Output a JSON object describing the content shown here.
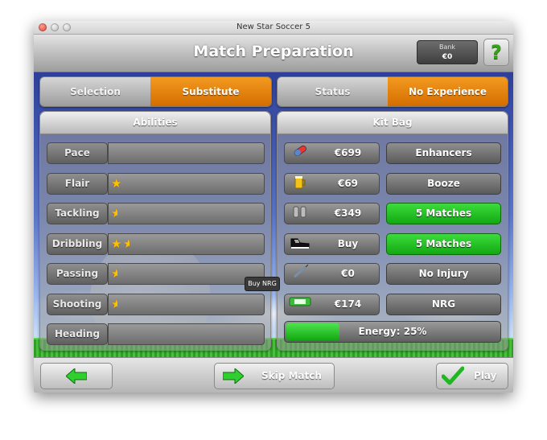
{
  "window": {
    "title": "New Star Soccer 5"
  },
  "header": {
    "title": "Match Preparation",
    "bank_label": "Bank",
    "bank_value": "€0",
    "help_label": "?"
  },
  "left_tabs": [
    {
      "label": "Selection",
      "active": false
    },
    {
      "label": "Substitute",
      "active": true
    }
  ],
  "right_tabs": [
    {
      "label": "Status",
      "active": false
    },
    {
      "label": "No Experience",
      "active": true
    }
  ],
  "abilities": {
    "title": "Abilities",
    "items": [
      {
        "label": "Pace",
        "stars": 0
      },
      {
        "label": "Flair",
        "stars": 1
      },
      {
        "label": "Tackling",
        "stars": 0.5
      },
      {
        "label": "Dribbling",
        "stars": 1.5
      },
      {
        "label": "Passing",
        "stars": 0.5
      },
      {
        "label": "Shooting",
        "stars": 0.5
      },
      {
        "label": "Heading",
        "stars": 0
      }
    ]
  },
  "kitbag": {
    "title": "Kit Bag",
    "items": [
      {
        "icon": "pill-icon",
        "price": "€699",
        "button": "Enhancers",
        "status": "normal"
      },
      {
        "icon": "beer-icon",
        "price": "€69",
        "button": "Booze",
        "status": "normal"
      },
      {
        "icon": "gloves-icon",
        "price": "€349",
        "button": "5 Matches",
        "status": "green"
      },
      {
        "icon": "boot-icon",
        "price": "Buy",
        "button": "5 Matches",
        "status": "green"
      },
      {
        "icon": "syringe-icon",
        "price": "€0",
        "button": "No Injury",
        "status": "normal"
      },
      {
        "icon": "energy-bar-icon",
        "price": "€174",
        "button": "NRG",
        "status": "normal"
      }
    ],
    "energy_label": "Energy: 25%",
    "energy_fraction": 0.25
  },
  "tooltip": "Buy NRG",
  "footer": {
    "back_icon": "left-arrow-icon",
    "skip_label": "Skip Match",
    "skip_icon": "right-arrow-icon",
    "play_label": "Play",
    "play_icon": "checkmark-icon"
  },
  "colors": {
    "accent_orange": "#e07d0a",
    "active_green": "#22c022",
    "sky": "#3d55b2"
  }
}
